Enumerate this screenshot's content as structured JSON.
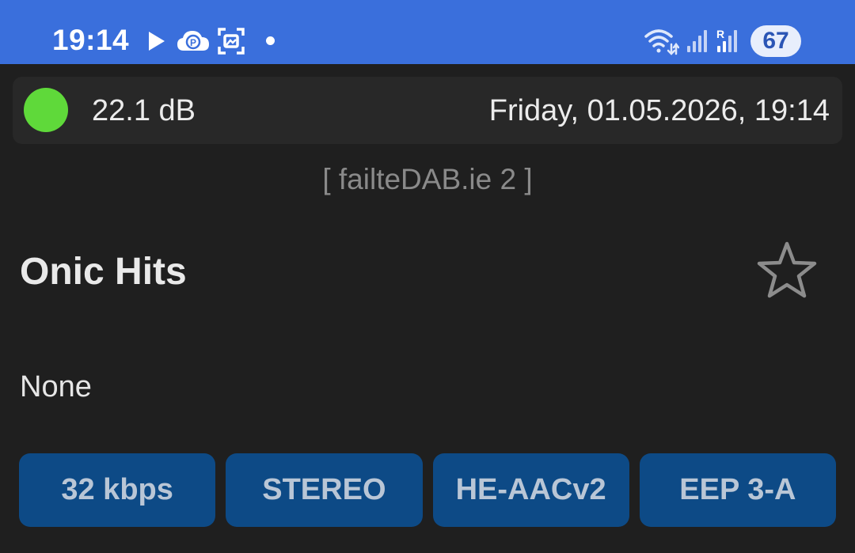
{
  "status_bar": {
    "time": "19:14",
    "battery": "67",
    "icons": [
      "play-icon",
      "cloud-p-icon",
      "screenshot-icon",
      "dot-icon",
      "wifi-icon",
      "signal-icon",
      "roaming-signal-icon"
    ]
  },
  "signal": {
    "level": "22.1 dB",
    "indicator_color": "#5fd93a"
  },
  "datetime": "Friday, 01.05.2026, 19:14",
  "ensemble": "[ failteDAB.ie 2 ]",
  "station": {
    "name": "Onic Hits",
    "favorite_icon": "star-outline-icon"
  },
  "dls_text": "None",
  "chips": [
    "32 kbps",
    "STEREO",
    "HE-AACv2",
    "EEP 3-A"
  ],
  "colors": {
    "status_bar": "#3a6fdc",
    "background": "#1f1f1f",
    "chip": "#0d4a86"
  }
}
